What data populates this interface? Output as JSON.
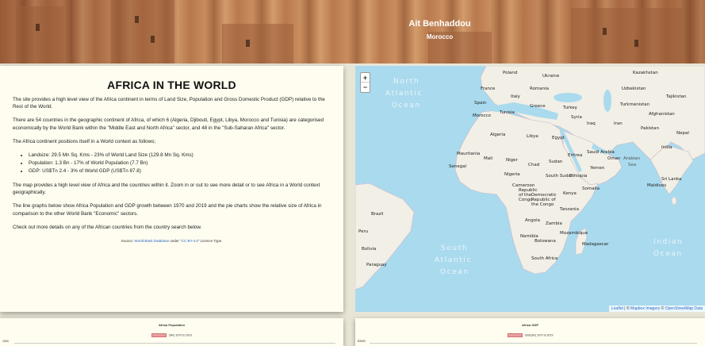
{
  "banner": {
    "title": "Ait Benhaddou",
    "subtitle": "Morocco"
  },
  "info": {
    "heading": "AFRICA IN THE WORLD",
    "p1": "The site provides a high level view of the Africa continent in terms of Land Size, Population and Gross Domestic Product (GDP) relative to the Rest of the World.",
    "p2": "There are 54 countries in the geographic continent of Africa, of which 6 (Algeria, Djibouti, Egypt, Libya, Morocco and Tunisia) are categorised economically by the World Bank within the \"Middle East and North Africa\" sector, and 48 in the \"Sub-Saharan Africa\" sector.",
    "p3": "The Africa continent positions itself in a World context as follows;",
    "bullets": [
      "Landsize: 29.5 Mn Sq. Kms - 23% of World Land Size (129.8 Mn Sq. Kms)",
      "Population: 1.3 Bn - 17% of World Population (7.7 Bn)",
      "GDP: US$Tn 2.4 - 3% of World GDP (US$Tn 87.8)"
    ],
    "p4": "The map provides a high level view of Africa and the countries within it. Zoom in or out to see more detail or to see Africa in a World context geographically.",
    "p5": "The line graphs below show Africa Population and GDP growth between 1970 and 2019 and the pie charts show the relative size of Africa in comparison to the other World Bank \"Economic\" sectors.",
    "p6": "Check out more details on any of the African countries from the country search below.",
    "source_prefix": "Source: ",
    "source_link": "World Bank Database",
    "source_mid": " under ",
    "source_license": "\"CC BY-4.0\"",
    "source_suffix": " Licence Type."
  },
  "map": {
    "zoom_in": "+",
    "zoom_out": "−",
    "oceans": {
      "north_atlantic_1": "North",
      "north_atlantic_2": "Atlantic",
      "north_atlantic_3": "Ocean",
      "south_atlantic_1": "South",
      "south_atlantic_2": "Atlantic",
      "south_atlantic_3": "Ocean",
      "indian_1": "Indian",
      "indian_2": "Ocean",
      "arabian_1": "Arabian",
      "arabian_2": "Sea"
    },
    "countries": {
      "poland": "Poland",
      "ukraine": "Ukraine",
      "kazakhstan": "Kazakhstan",
      "uzbekistan": "Uzbekistan",
      "tajikistan": "Tajikistan",
      "romania": "Romania",
      "france": "France",
      "italy": "Italy",
      "turkey": "Turkey",
      "turkmenistan": "Turkmenistan",
      "spain": "Spain",
      "greece": "Greece",
      "afghanistan": "Afghanistan",
      "tunisia": "Tunisia",
      "syria": "Syria",
      "iraq": "Iraq",
      "iran": "Iran",
      "pakistan": "Pakistan",
      "morocco": "Morocco",
      "nepal": "Nepal",
      "algeria": "Algeria",
      "libya": "Libya",
      "egypt": "Egypt",
      "india": "India",
      "saudi_arabia": "Saudi Arabia",
      "mauritania": "Mauritania",
      "mali": "Mali",
      "niger": "Niger",
      "oman": "Oman",
      "senegal": "Senegal",
      "chad": "Chad",
      "sudan": "Sudan",
      "eritrea": "Eritrea",
      "yemen": "Yemen",
      "nigeria": "Nigeria",
      "ethiopia": "Ethiopia",
      "sri_lanka": "Sri Lanka",
      "south_sudan": "South Sudan",
      "cameroon": "Cameroon",
      "somalia": "Somalia",
      "maldives": "Maldives",
      "republic_congo_1": "Republic",
      "republic_congo_2": "of the",
      "republic_congo_3": "Congo",
      "drc_1": "Democratic",
      "drc_2": "Republic of",
      "drc_3": "the Congo",
      "kenya": "Kenya",
      "tanzania": "Tanzania",
      "brazil": "Brazil",
      "peru": "Peru",
      "angola": "Angola",
      "zambia": "Zambia",
      "namibia": "Namibia",
      "bolivia": "Bolivia",
      "botswana": "Botswana",
      "madagascar": "Madagascar",
      "mozambique": "Mozambique",
      "south_africa": "South Africa",
      "paraguay": "Paraguay"
    },
    "attribution_leaflet": "Leaflet",
    "attribution_sep": " | © ",
    "attribution_mapbox": "Mapbox Imagery",
    "attribution_sep2": " © ",
    "attribution_osm": "OpenStreetMap Data"
  },
  "charts": {
    "population": {
      "title": "Africa Population",
      "legend": "(Mn) 1970 to 2019",
      "y_top_tick": "1500"
    },
    "gdp": {
      "title": "Africa GDP",
      "legend": "US$ (Bn) 1970 to 2019",
      "y_top_tick": "$3000"
    }
  },
  "colors": {
    "land": "#f2efe6",
    "water": "#aadaee",
    "panel_bg": "#fefdf0",
    "page_bg": "#e9e5d6",
    "link": "#2a67c9",
    "legend_swatch": "#e8a0a0"
  }
}
